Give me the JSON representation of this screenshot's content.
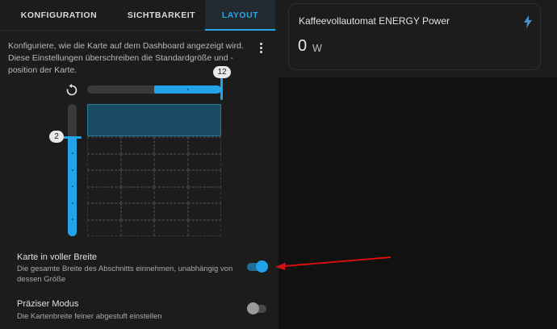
{
  "tabs": [
    {
      "label": "KONFIGURATION",
      "active": false
    },
    {
      "label": "SICHTBARKEIT",
      "active": false
    },
    {
      "label": "LAYOUT",
      "active": true
    }
  ],
  "layout": {
    "description": "Konfiguriere, wie die Karte auf dem Dashboard angezeigt wird. Diese Einstellungen überschreiben die Standardgröße und -position der Karte.",
    "menu_icon": "dots-vertical-icon",
    "reset_icon": "restore-icon",
    "columns_value": "12",
    "rows_value": "2"
  },
  "options": {
    "full_width": {
      "title": "Karte in voller Breite",
      "subtitle": "Die gesamte Breite des Abschnitts einnehmen, unabhängig von dessen Größe",
      "enabled": true
    },
    "precise": {
      "title": "Präziser Modus",
      "subtitle": "Die Kartenbreite feiner abgestuft einstellen",
      "enabled": false
    }
  },
  "preview_card": {
    "title": "Kaffeevollautomat ENERGY Power",
    "value": "0",
    "unit": "W",
    "icon": "flash-icon"
  },
  "colors": {
    "accent": "#29a6e6",
    "annotation_arrow": "#d41010"
  }
}
